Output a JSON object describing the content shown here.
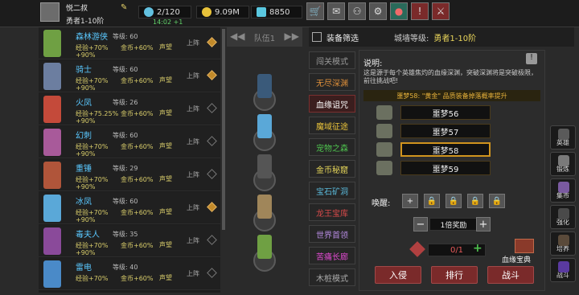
{
  "player": {
    "name": "悦二叔",
    "level": "勇者1-10阶"
  },
  "resources": {
    "stamina": "2/120",
    "timer": "14:02 +1",
    "gold": "9.09M",
    "gems": "8850"
  },
  "top_buttons": [
    "cart-icon",
    "mail-icon",
    "gamepad-icon",
    "gear-icon",
    "color-wheel-icon",
    "alert-icon",
    "swords-icon"
  ],
  "heroes": [
    {
      "name": "森林游侠",
      "lv": "等级: 60",
      "exp": "经验+70%",
      "gold": "金币+60%",
      "fame": "声望",
      "pct": "+90%",
      "act": "上阵",
      "on": true,
      "color": "#6fa043"
    },
    {
      "name": "骑士",
      "lv": "等级: 60",
      "exp": "经验+70%",
      "gold": "金币+60%",
      "fame": "声望",
      "pct": "+90%",
      "act": "上阵",
      "on": true,
      "color": "#6c7ea0"
    },
    {
      "name": "火凤",
      "lv": "等级: 26",
      "exp": "经验+75.25%",
      "gold": "金币+60%",
      "fame": "声望",
      "pct": "+90%",
      "act": "上阵",
      "on": false,
      "color": "#c44a3a"
    },
    {
      "name": "幻刺",
      "lv": "等级: 60",
      "exp": "经验+70%",
      "gold": "金币+60%",
      "fame": "声望",
      "pct": "+90%",
      "act": "上阵",
      "on": false,
      "color": "#a85a9a"
    },
    {
      "name": "重锤",
      "lv": "等级: 29",
      "exp": "经验+70%",
      "gold": "金币+60%",
      "fame": "声望",
      "pct": "+90%",
      "act": "上阵",
      "on": false,
      "color": "#b0553a"
    },
    {
      "name": "冰凤",
      "lv": "等级: 60",
      "exp": "经验+70%",
      "gold": "金币+60%",
      "fame": "声望",
      "pct": "+90%",
      "act": "上阵",
      "on": true,
      "color": "#5aa8d8"
    },
    {
      "name": "毒夫人",
      "lv": "等级: 35",
      "exp": "经验+70%",
      "gold": "金币+60%",
      "fame": "声望",
      "pct": "+90%",
      "act": "上阵",
      "on": false,
      "color": "#8a4a9a"
    },
    {
      "name": "雷电",
      "lv": "等级: 40",
      "exp": "经验+70%",
      "gold": "金币+60%",
      "fame": "声望",
      "pct": "",
      "act": "上阵",
      "on": false,
      "color": "#4a8ac8"
    }
  ],
  "team": {
    "label": "队伍1"
  },
  "filter": {
    "title": "装备筛选",
    "wall_label": "城墙等级:",
    "wall_value": "勇者1-10阶"
  },
  "modes": [
    "闯关模式",
    "无尽深渊",
    "血缘诅咒",
    "魔域征途",
    "宠物之森",
    "金币秘窟",
    "宝石矿洞",
    "龙王宝库",
    "世界首领",
    "苦痛长廊",
    "木桩模式"
  ],
  "mode_colors": [
    "#9a9a9a",
    "#e0903a",
    "#ffffff",
    "#e8c23a",
    "#4ec24e",
    "#e8d85a",
    "#5ab8d8",
    "#d84a4a",
    "#b58ae0",
    "#e04ad0",
    "#aaaaaa"
  ],
  "info": {
    "label": "说明:",
    "text": "这是源于每个英雄焦灼的血缘深渊，突破深渊将是突破极限，前往挑战吧!",
    "banner": "噩梦58: \"黄金\" 品质装备掉落概率提升"
  },
  "stages": [
    "噩梦56",
    "噩梦57",
    "噩梦58",
    "噩梦59"
  ],
  "awaken": {
    "label": "唤醒:",
    "plus": "+",
    "lock": "🔒"
  },
  "bonus": {
    "label": "1倍奖励",
    "minus": "−",
    "plus": "+"
  },
  "ticket": {
    "value": "0/1"
  },
  "treasure": {
    "label": "血缘宝典"
  },
  "actions": {
    "invade": "入侵",
    "rank": "排行",
    "fight": "战斗"
  },
  "side_menu": [
    "英雄",
    "锻炼",
    "集市",
    "强化",
    "培养",
    "战斗"
  ]
}
